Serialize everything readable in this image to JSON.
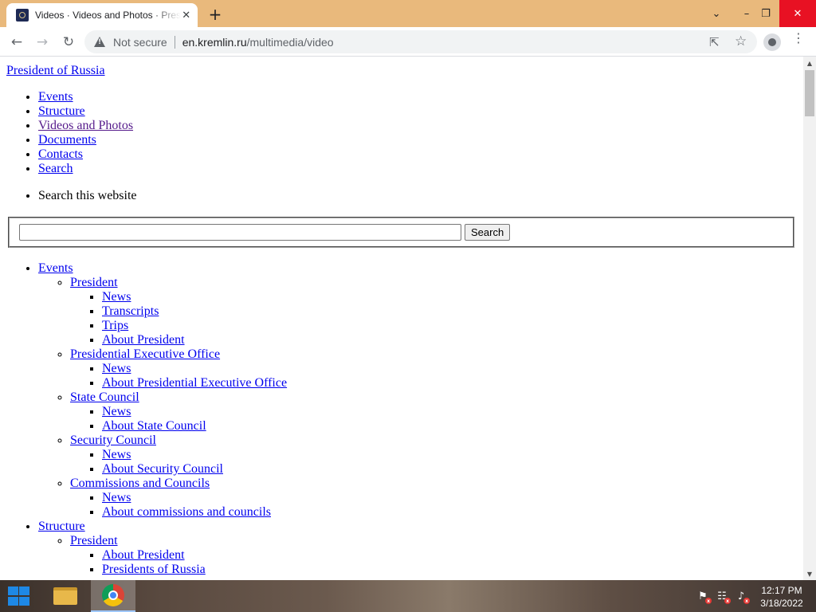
{
  "browser": {
    "tab_title": "Videos · Videos and Photos · President of Russia",
    "tab_close_glyph": "✕",
    "new_tab_glyph": "+",
    "window_controls": {
      "dropdown": "⌄",
      "minimize": "–",
      "restore": "❐",
      "close": "✕"
    },
    "toolbar": {
      "back": "←",
      "forward": "→",
      "reload": "↻",
      "share": "⇱",
      "bookmark": "☆",
      "menu": "⋮"
    },
    "security_label": "Not secure",
    "url_host": "en.kremlin.ru",
    "url_path": "/multimedia/video"
  },
  "page": {
    "site_title": "President of Russia",
    "nav": [
      {
        "label": "Events"
      },
      {
        "label": "Structure"
      },
      {
        "label": "Videos and Photos"
      },
      {
        "label": "Documents"
      },
      {
        "label": "Contacts"
      },
      {
        "label": "Search"
      }
    ],
    "search": {
      "caption": "Search this website",
      "value": "",
      "button_label": "Search"
    },
    "sitemap": [
      {
        "label": "Events",
        "children": [
          {
            "label": "President",
            "children": [
              {
                "label": "News"
              },
              {
                "label": "Transcripts"
              },
              {
                "label": "Trips"
              },
              {
                "label": "About President"
              }
            ]
          },
          {
            "label": "Presidential Executive Office",
            "children": [
              {
                "label": "News"
              },
              {
                "label": "About Presidential Executive Office"
              }
            ]
          },
          {
            "label": "State Council",
            "children": [
              {
                "label": "News"
              },
              {
                "label": "About State Council"
              }
            ]
          },
          {
            "label": "Security Council",
            "children": [
              {
                "label": "News"
              },
              {
                "label": "About Security Council"
              }
            ]
          },
          {
            "label": "Commissions and Councils",
            "children": [
              {
                "label": "News"
              },
              {
                "label": "About commissions and councils"
              }
            ]
          }
        ]
      },
      {
        "label": "Structure",
        "children": [
          {
            "label": "President",
            "children": [
              {
                "label": "About President"
              },
              {
                "label": "Presidents of Russia"
              }
            ]
          }
        ]
      }
    ]
  },
  "scrollbar": {
    "up": "▲",
    "down": "▼"
  },
  "taskbar": {
    "time": "12:17 PM",
    "date": "3/18/2022",
    "tray": {
      "flag": "⚑",
      "network": "☷",
      "volume": "♪"
    }
  },
  "colors": {
    "tab_strip": "#e9b97c",
    "link": "#0000ee",
    "visited_link": "#551a8b"
  }
}
